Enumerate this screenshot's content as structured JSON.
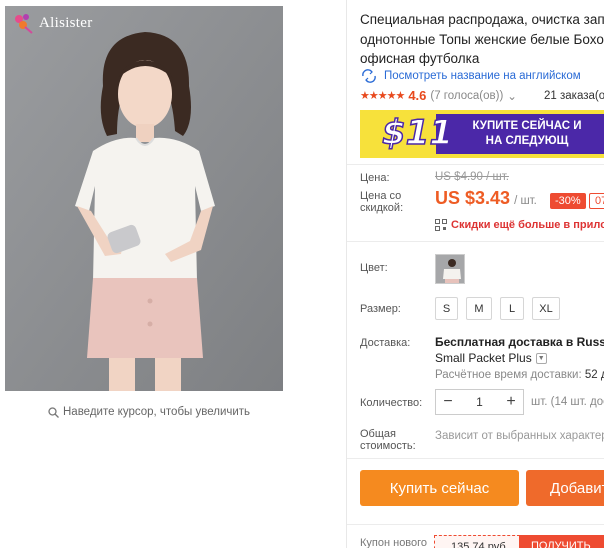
{
  "brand": {
    "name": "Alisister",
    "icon": "brand-logo-icon"
  },
  "image": {
    "zoom_hint": "Наведите курсор, чтобы увеличить"
  },
  "product": {
    "title_lines": [
      "Специальная распродажа, очистка запа",
      "однотонные Топы женские белые Бохо",
      "офисная футболка"
    ],
    "translate_link": "Посмотреть название на английском",
    "rating": "4.6",
    "votes": "(7 голоса(ов))",
    "orders": "21 заказа(ов"
  },
  "banner": {
    "amount": "$11",
    "line1": "КУПИТЕ СЕЙЧАС И",
    "line2": "НА СЛЕДУЮЩ",
    "colors": {
      "bg": "#f7e13b",
      "accent": "#4b28a8"
    }
  },
  "price": {
    "label": "Цена:",
    "old": "US $4.90 / шт.",
    "discount_label_1": "Цена со",
    "discount_label_2": "скидкой:",
    "new": "US $3.43",
    "per_unit": "/ шт.",
    "discount": "-30%",
    "badge2": "07",
    "app_promo": "Скидки ещё больше в прилож",
    "accent": "#ee5c24"
  },
  "color": {
    "label": "Цвет:"
  },
  "size": {
    "label": "Размер:",
    "options": [
      "S",
      "M",
      "L",
      "XL"
    ]
  },
  "shipping": {
    "label": "Доставка:",
    "title": "Бесплатная доставка в Russian",
    "method": "Small Packet Plus",
    "est_label": "Расчётное время доставки:",
    "est_value": "52 дн"
  },
  "quantity": {
    "label": "Количество:",
    "value": "1",
    "minus": "−",
    "plus": "+",
    "note": "шт. (14 шт. дос"
  },
  "total": {
    "label_1": "Общая",
    "label_2": "стоимость:",
    "note": "Зависит от выбранных характери"
  },
  "actions": {
    "buy": "Купить сейчас",
    "cart": "Добавит",
    "buy_color": "#f58a1f",
    "cart_color": "#ef6a2b"
  },
  "coupon": {
    "label": "Купон нового",
    "value": "135,74 руб.",
    "get": "ПОЛУЧИТЬ"
  }
}
